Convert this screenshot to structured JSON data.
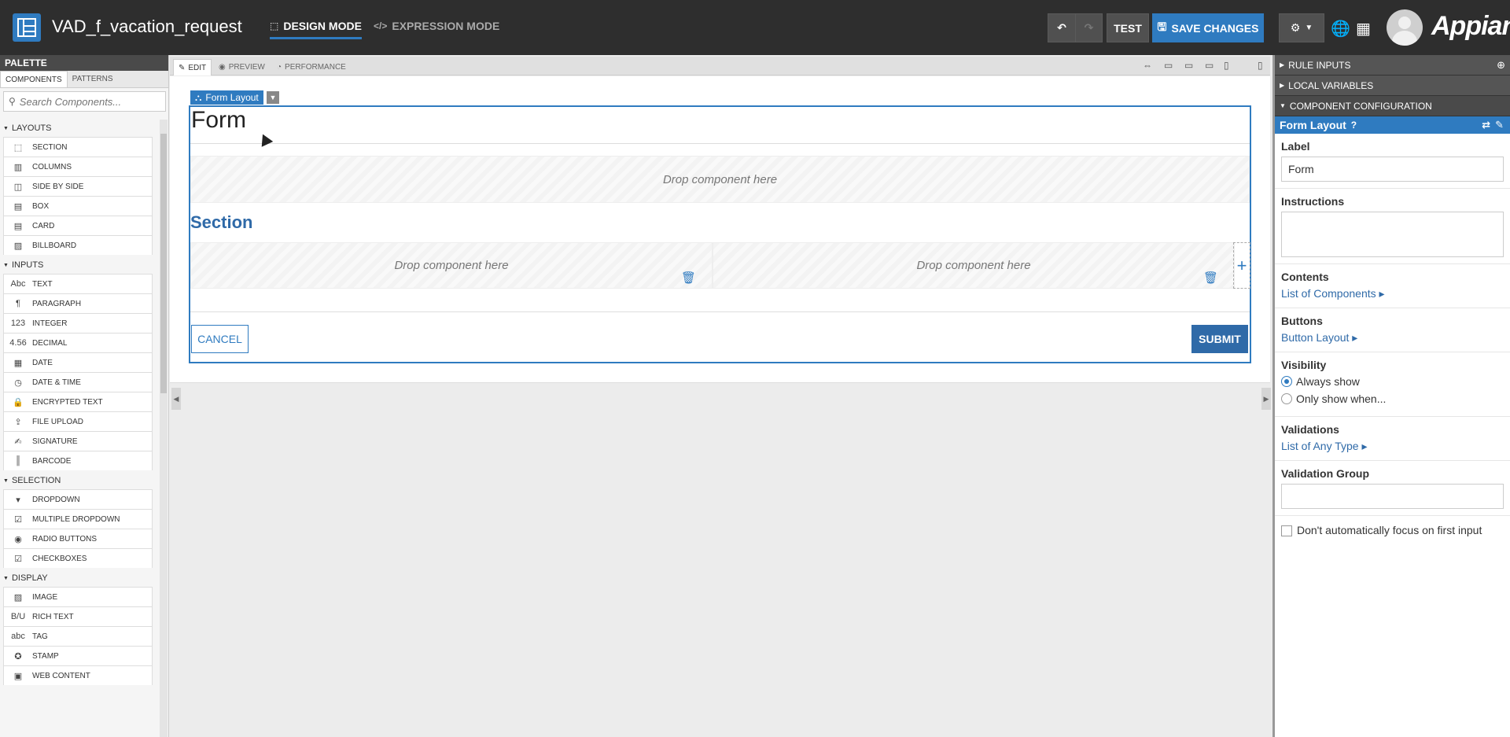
{
  "app": {
    "title": "VAD_f_vacation_request",
    "brand": "Appian"
  },
  "header": {
    "modes": [
      {
        "label": "DESIGN MODE",
        "active": true
      },
      {
        "label": "EXPRESSION MODE",
        "active": false
      }
    ],
    "test_label": "TEST",
    "save_label": "SAVE CHANGES",
    "accent_color": "#2f7bc0"
  },
  "palette": {
    "title": "PALETTE",
    "tabs": [
      "COMPONENTS",
      "PATTERNS"
    ],
    "search_placeholder": "Search Components...",
    "categories": [
      {
        "name": "LAYOUTS",
        "items": [
          {
            "label": "SECTION",
            "icon": "section-icon",
            "glyph": "⬚"
          },
          {
            "label": "COLUMNS",
            "icon": "columns-icon",
            "glyph": "▥"
          },
          {
            "label": "SIDE BY SIDE",
            "icon": "side-by-side-icon",
            "glyph": "◫"
          },
          {
            "label": "BOX",
            "icon": "box-icon",
            "glyph": "▤"
          },
          {
            "label": "CARD",
            "icon": "card-icon",
            "glyph": "▤"
          },
          {
            "label": "BILLBOARD",
            "icon": "billboard-icon",
            "glyph": "▨"
          }
        ]
      },
      {
        "name": "INPUTS",
        "items": [
          {
            "label": "TEXT",
            "icon": "text-icon",
            "glyph": "Abc"
          },
          {
            "label": "PARAGRAPH",
            "icon": "paragraph-icon",
            "glyph": "¶"
          },
          {
            "label": "INTEGER",
            "icon": "integer-icon",
            "glyph": "123"
          },
          {
            "label": "DECIMAL",
            "icon": "decimal-icon",
            "glyph": "4.56"
          },
          {
            "label": "DATE",
            "icon": "date-icon",
            "glyph": "▦"
          },
          {
            "label": "DATE & TIME",
            "icon": "date-time-icon",
            "glyph": "◷"
          },
          {
            "label": "ENCRYPTED TEXT",
            "icon": "lock-icon",
            "glyph": "🔒"
          },
          {
            "label": "FILE UPLOAD",
            "icon": "upload-icon",
            "glyph": "⇪"
          },
          {
            "label": "SIGNATURE",
            "icon": "signature-icon",
            "glyph": "✍"
          },
          {
            "label": "BARCODE",
            "icon": "barcode-icon",
            "glyph": "║"
          }
        ]
      },
      {
        "name": "SELECTION",
        "items": [
          {
            "label": "DROPDOWN",
            "icon": "dropdown-icon",
            "glyph": "▾"
          },
          {
            "label": "MULTIPLE DROPDOWN",
            "icon": "multiple-dropdown-icon",
            "glyph": "☑"
          },
          {
            "label": "RADIO BUTTONS",
            "icon": "radio-icon",
            "glyph": "◉"
          },
          {
            "label": "CHECKBOXES",
            "icon": "checkbox-icon",
            "glyph": "☑"
          }
        ]
      },
      {
        "name": "DISPLAY",
        "items": [
          {
            "label": "IMAGE",
            "icon": "image-icon",
            "glyph": "▨"
          },
          {
            "label": "RICH TEXT",
            "icon": "rich-text-icon",
            "glyph": "B/U"
          },
          {
            "label": "TAG",
            "icon": "tag-icon",
            "glyph": "abc"
          },
          {
            "label": "STAMP",
            "icon": "stamp-icon",
            "glyph": "✪"
          },
          {
            "label": "WEB CONTENT",
            "icon": "web-content-icon",
            "glyph": "▣"
          }
        ]
      }
    ]
  },
  "center": {
    "tabs": [
      {
        "label": "EDIT",
        "icon": "pencil-icon"
      },
      {
        "label": "PREVIEW",
        "icon": "eye-icon"
      },
      {
        "label": "PERFORMANCE",
        "icon": "gauge-icon"
      }
    ],
    "form_chip": "Form Layout",
    "form_title": "Form",
    "drop_text": "Drop component here",
    "section_title": "Section",
    "cancel_label": "CANCEL",
    "submit_label": "SUBMIT"
  },
  "rpanel": {
    "rule_inputs": "RULE INPUTS",
    "local_variables": "LOCAL VARIABLES",
    "component_configuration": "COMPONENT CONFIGURATION",
    "component_name": "Form Layout",
    "label_title": "Label",
    "label_value": "Form",
    "instructions_title": "Instructions",
    "contents_title": "Contents",
    "contents_link": "List of Components",
    "buttons_title": "Buttons",
    "buttons_link": "Button Layout",
    "visibility_title": "Visibility",
    "visibility_options": [
      "Always show",
      "Only show when..."
    ],
    "validations_title": "Validations",
    "validations_link": "List of Any Type",
    "validation_group_title": "Validation Group",
    "focus_label": "Don't automatically focus on first input"
  }
}
